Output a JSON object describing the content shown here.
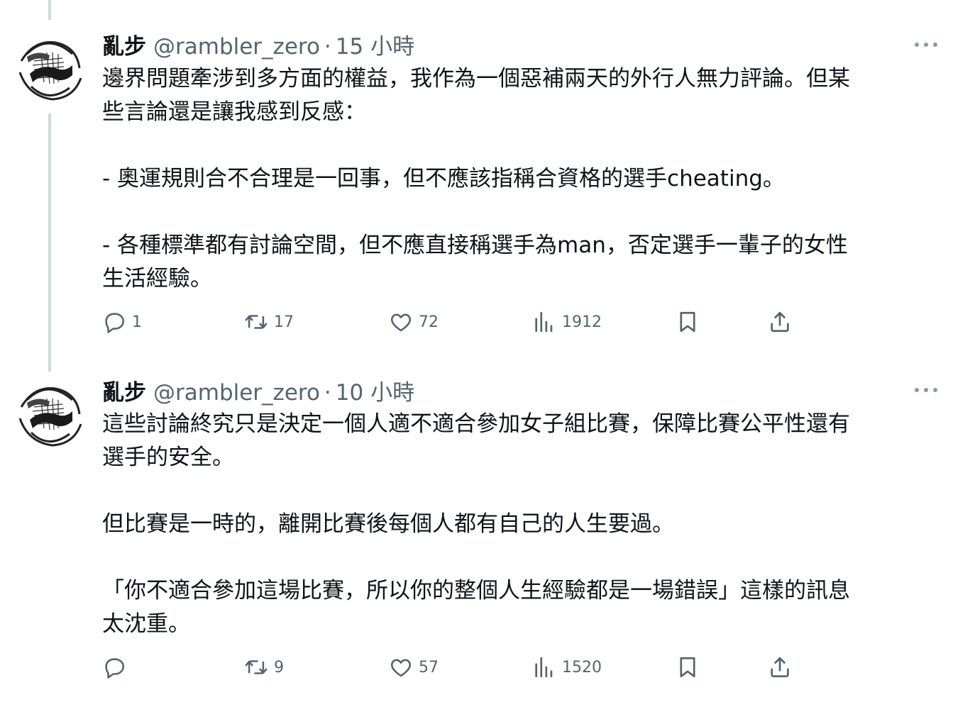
{
  "tweets": [
    {
      "author": "亂步",
      "handle": "@rambler_zero",
      "separator": "·",
      "time": "15 小時",
      "lines": [
        "邊界問題牽涉到多方面的權益，我作為一個惡補兩天的外行人無力評論。但某",
        "些言論還是讓我感到反感：",
        "",
        "- 奧運規則合不合理是一回事，但不應該指稱合資格的選手cheating。",
        "",
        "- 各種標準都有討論空間，但不應直接稱選手為man，否定選手一輩子的女性",
        "生活經驗。"
      ],
      "replies": "1",
      "reposts": "17",
      "likes": "72",
      "views": "1912"
    },
    {
      "author": "亂步",
      "handle": "@rambler_zero",
      "separator": "·",
      "time": "10 小時",
      "lines": [
        "這些討論終究只是決定一個人適不適合參加女子組比賽，保障比賽公平性還有",
        "選手的安全。",
        "",
        "但比賽是一時的，離開比賽後每個人都有自己的人生要過。",
        "",
        "「你不適合參加這場比賽，所以你的整個人生經驗都是一場錯誤」這樣的訊息",
        "太沈重。"
      ],
      "replies": "",
      "reposts": "9",
      "likes": "57",
      "views": "1520"
    }
  ],
  "icons": {
    "reply": "reply-icon",
    "repost": "repost-icon",
    "like": "heart-icon",
    "views": "views-icon",
    "bookmark": "bookmark-icon",
    "share": "share-icon",
    "more": "more-icon"
  },
  "colors": {
    "text": "#0f1419",
    "secondary": "#536471",
    "thread_line": "#cfd9de"
  }
}
